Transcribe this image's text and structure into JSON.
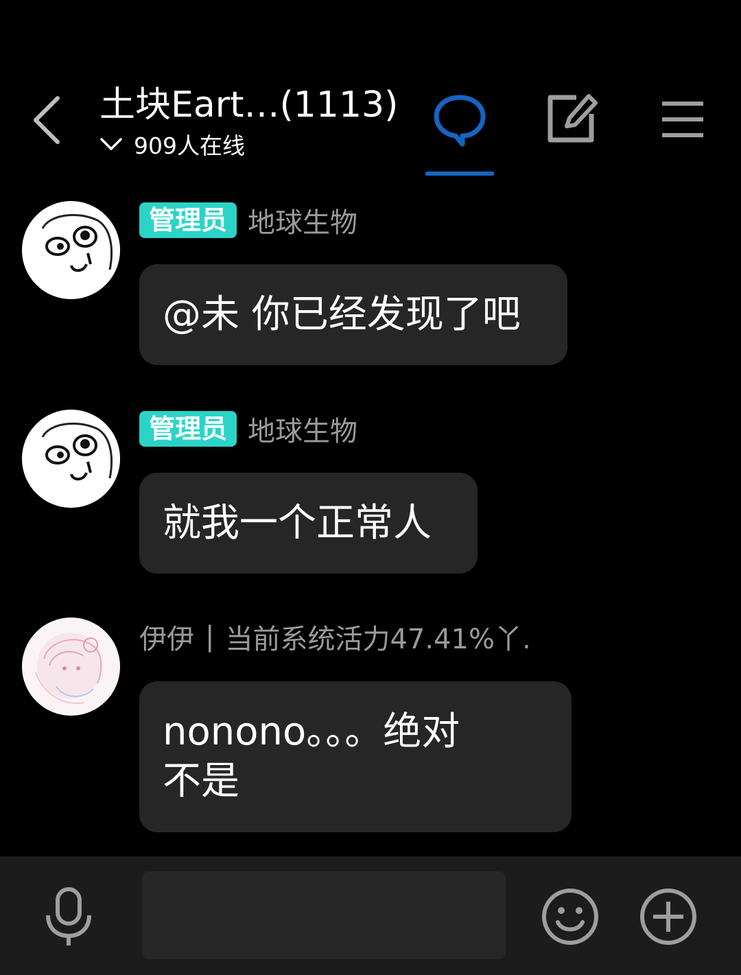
{
  "header": {
    "title": "土块Eart…(1113)",
    "online_count": "909人在线",
    "active_tab": "chat",
    "accent_color": "#1565c0"
  },
  "messages": [
    {
      "badge": "管理员",
      "sender": "地球生物",
      "text": "@未 你已经发现了吧",
      "avatar": "rage-face-avatar"
    },
    {
      "badge": "管理员",
      "sender": "地球生物",
      "text": "就我一个正常人",
      "avatar": "rage-face-avatar"
    },
    {
      "sender": "伊伊",
      "sender_separator": "|",
      "sender_suffix": "当前系统活力47.41%丫.",
      "text_line1": "nonono。。。绝对",
      "text_line2": "不是",
      "avatar": "anime-sketch-avatar"
    }
  ],
  "colors": {
    "admin_badge": "#2bd4c7",
    "bubble_bg": "#262626",
    "bottom_bar_bg": "#1c1c1c"
  },
  "input": {
    "placeholder": "",
    "value": ""
  },
  "icons": {
    "back": "chevron-left-icon",
    "chat_tab": "chat-bubble-icon",
    "edit_tab": "edit-icon",
    "menu_tab": "menu-icon",
    "mic": "microphone-icon",
    "emoji": "smiley-icon",
    "plus": "plus-icon"
  }
}
